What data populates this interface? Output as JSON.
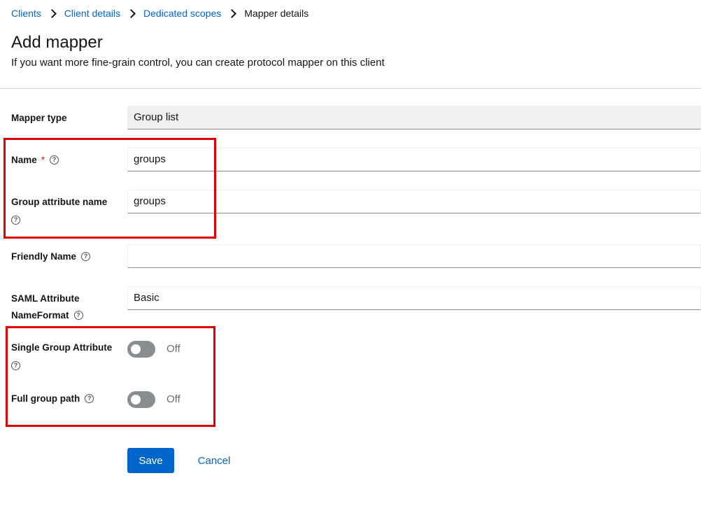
{
  "breadcrumb": {
    "items": [
      "Clients",
      "Client details",
      "Dedicated scopes"
    ],
    "current": "Mapper details"
  },
  "header": {
    "title": "Add mapper",
    "subtitle": "If you want more fine-grain control, you can create protocol mapper on this client"
  },
  "form": {
    "mapper_type": {
      "label": "Mapper type",
      "value": "Group list"
    },
    "name": {
      "label": "Name",
      "required_mark": "*",
      "value": "groups"
    },
    "group_attribute_name": {
      "label": "Group attribute name",
      "value": "groups"
    },
    "friendly_name": {
      "label": "Friendly Name",
      "value": ""
    },
    "saml_nameformat": {
      "label_line1": "SAML Attribute",
      "label_line2": "NameFormat",
      "value": "Basic"
    },
    "single_group_attribute": {
      "label": "Single Group Attribute",
      "state_text": "Off",
      "checked": false
    },
    "full_group_path": {
      "label": "Full group path",
      "state_text": "Off",
      "checked": false
    }
  },
  "help_glyph": "?",
  "actions": {
    "save": "Save",
    "cancel": "Cancel"
  },
  "colors": {
    "link": "#0066cc",
    "primary_button": "#0066cc",
    "required": "#c9190b",
    "highlight_box": "#e00000",
    "switch_off": "#8a8d90"
  }
}
